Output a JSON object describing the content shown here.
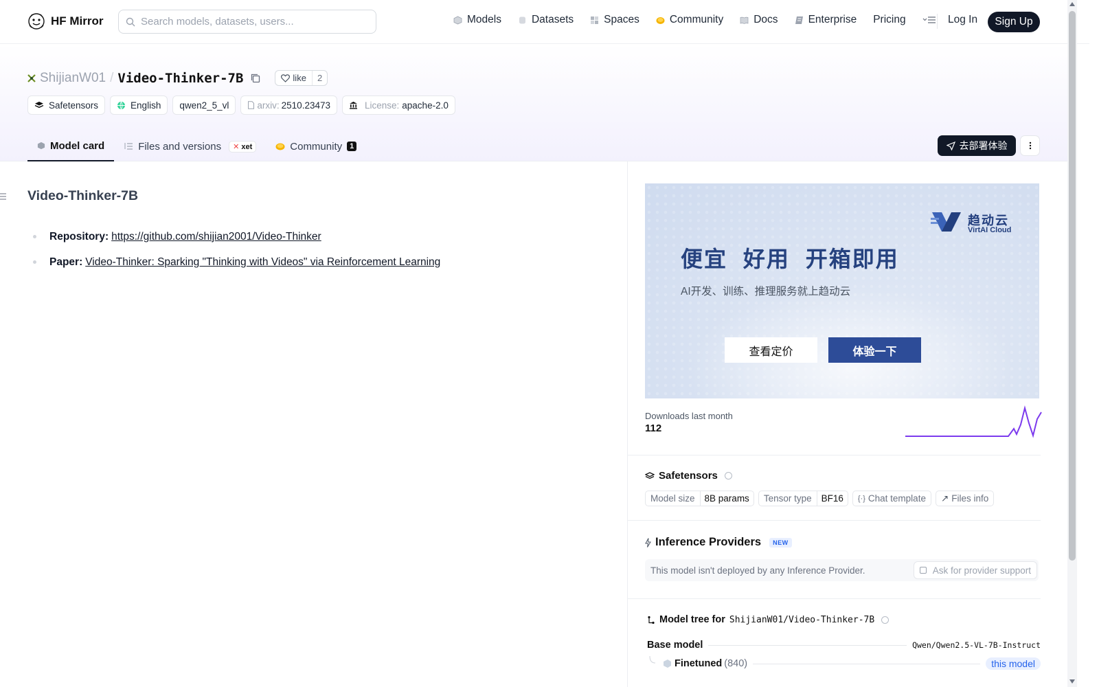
{
  "navbar": {
    "brand": "HF Mirror",
    "search_placeholder": "Search models, datasets, users...",
    "links": [
      {
        "label": "Models",
        "icon": "cube-icon",
        "color": "#9ca3af"
      },
      {
        "label": "Datasets",
        "icon": "database-icon",
        "color": "#c4c8d0"
      },
      {
        "label": "Spaces",
        "icon": "grid-icon",
        "color": "#9ca3af"
      },
      {
        "label": "Community",
        "icon": "hug-icon",
        "color": "#f5b400"
      },
      {
        "label": "Docs",
        "icon": "book-icon",
        "color": "#9ca3af"
      },
      {
        "label": "Enterprise",
        "icon": "enterprise-icon",
        "color": "#6b7280"
      },
      {
        "label": "Pricing",
        "icon": "",
        "color": ""
      }
    ],
    "login": "Log In",
    "signup": "Sign Up"
  },
  "repo": {
    "owner": "ShijianW01",
    "name": "Video-Thinker-7B",
    "like_label": "like",
    "like_count": "2",
    "tags": {
      "safetensors": "Safetensors",
      "language": "English",
      "arch": "qwen2_5_vl",
      "arxiv_prefix": "arxiv:",
      "arxiv_id": "2510.23473",
      "license_prefix": "License:",
      "license": "apache-2.0"
    },
    "tabs": {
      "model_card": "Model card",
      "files": "Files and versions",
      "xet": "xet",
      "community": "Community",
      "community_count": "1"
    },
    "deploy_label": "去部署体验"
  },
  "readme": {
    "heading": "Video-Thinker-7B",
    "repository_label": "Repository:",
    "repository_link": "https://github.com/shijian2001/Video-Thinker",
    "paper_label": "Paper:",
    "paper_link": "Video-Thinker: Sparking \"Thinking with Videos\" via Reinforcement Learning"
  },
  "ad": {
    "headline": "便宜 好用 开箱即用",
    "sub": "AI开发、训练、推理服务就上趋动云",
    "logo_cn": "趋动云",
    "logo_en": "VirtAI Cloud",
    "btn_price": "查看定价",
    "btn_try": "体验一下"
  },
  "downloads": {
    "label": "Downloads last month",
    "count": "112",
    "spark_color": "#7c3aed"
  },
  "safetensors": {
    "title": "Safetensors",
    "model_size_label": "Model size",
    "model_size": "8B params",
    "tensor_type_label": "Tensor type",
    "tensor_type": "BF16",
    "chat_template": "Chat template",
    "files_info": "Files info"
  },
  "inference": {
    "title": "Inference Providers",
    "badge": "NEW",
    "message": "This model isn't deployed by any Inference Provider.",
    "ask": "Ask for provider support"
  },
  "model_tree": {
    "title_prefix": "Model tree for",
    "repo_id": "ShijianW01/Video-Thinker-7B",
    "base_label": "Base model",
    "base_value": "Qwen/Qwen2.5-VL-7B-Instruct",
    "finetuned_label": "Finetuned",
    "finetuned_count": "(840)",
    "this_model": "this model"
  }
}
